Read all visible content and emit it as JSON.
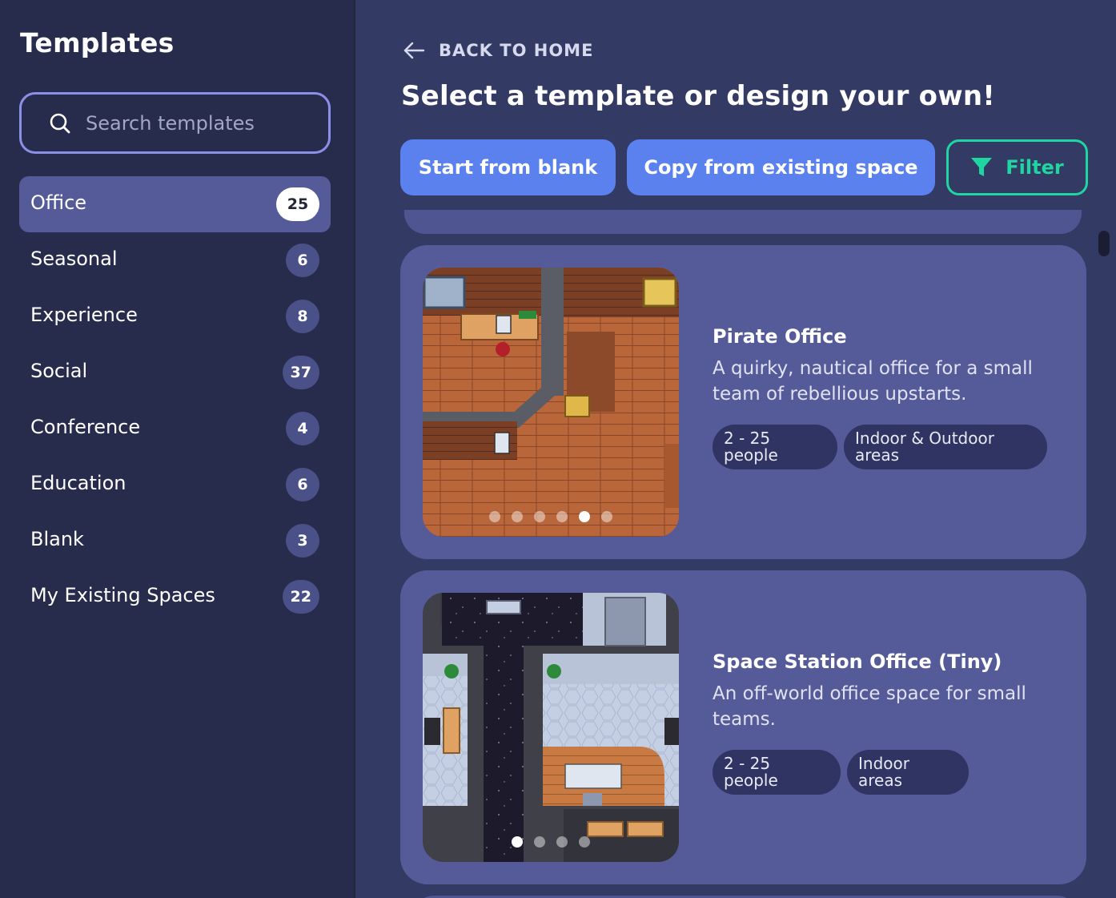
{
  "sidebar": {
    "title": "Templates",
    "search": {
      "placeholder": "Search templates",
      "value": ""
    },
    "categories": [
      {
        "label": "Office",
        "count": "25",
        "active": true
      },
      {
        "label": "Seasonal",
        "count": "6"
      },
      {
        "label": "Experience",
        "count": "8"
      },
      {
        "label": "Social",
        "count": "37"
      },
      {
        "label": "Conference",
        "count": "4"
      },
      {
        "label": "Education",
        "count": "6"
      },
      {
        "label": "Blank",
        "count": "3"
      },
      {
        "label": "My Existing Spaces",
        "count": "22"
      }
    ]
  },
  "main": {
    "back_label": "BACK TO HOME",
    "title": "Select a template or design your own!",
    "buttons": {
      "blank": "Start from blank",
      "copy": "Copy from existing space",
      "filter": "Filter"
    },
    "templates": [
      {
        "title": "Pirate Office",
        "description": "A quirky, nautical office for a small team of rebellious upstarts.",
        "tags": [
          "2 - 25 people",
          "Indoor & Outdoor areas"
        ],
        "slide_count": 6,
        "active_slide": 5
      },
      {
        "title": "Space Station Office (Tiny)",
        "description": "An off-world office space for small teams.",
        "tags": [
          "2 - 25 people",
          "Indoor areas"
        ],
        "slide_count": 4,
        "active_slide": 1
      }
    ]
  },
  "colors": {
    "sidebar_bg": "#282c4c",
    "main_bg": "#333a64",
    "card_bg": "#555b99",
    "primary_button": "#5b81ee",
    "filter_accent": "#1fd6a0",
    "search_border": "#8c8fe8"
  },
  "icons": {
    "search": "search-icon",
    "back": "arrow-left-icon",
    "filter": "funnel-icon"
  }
}
